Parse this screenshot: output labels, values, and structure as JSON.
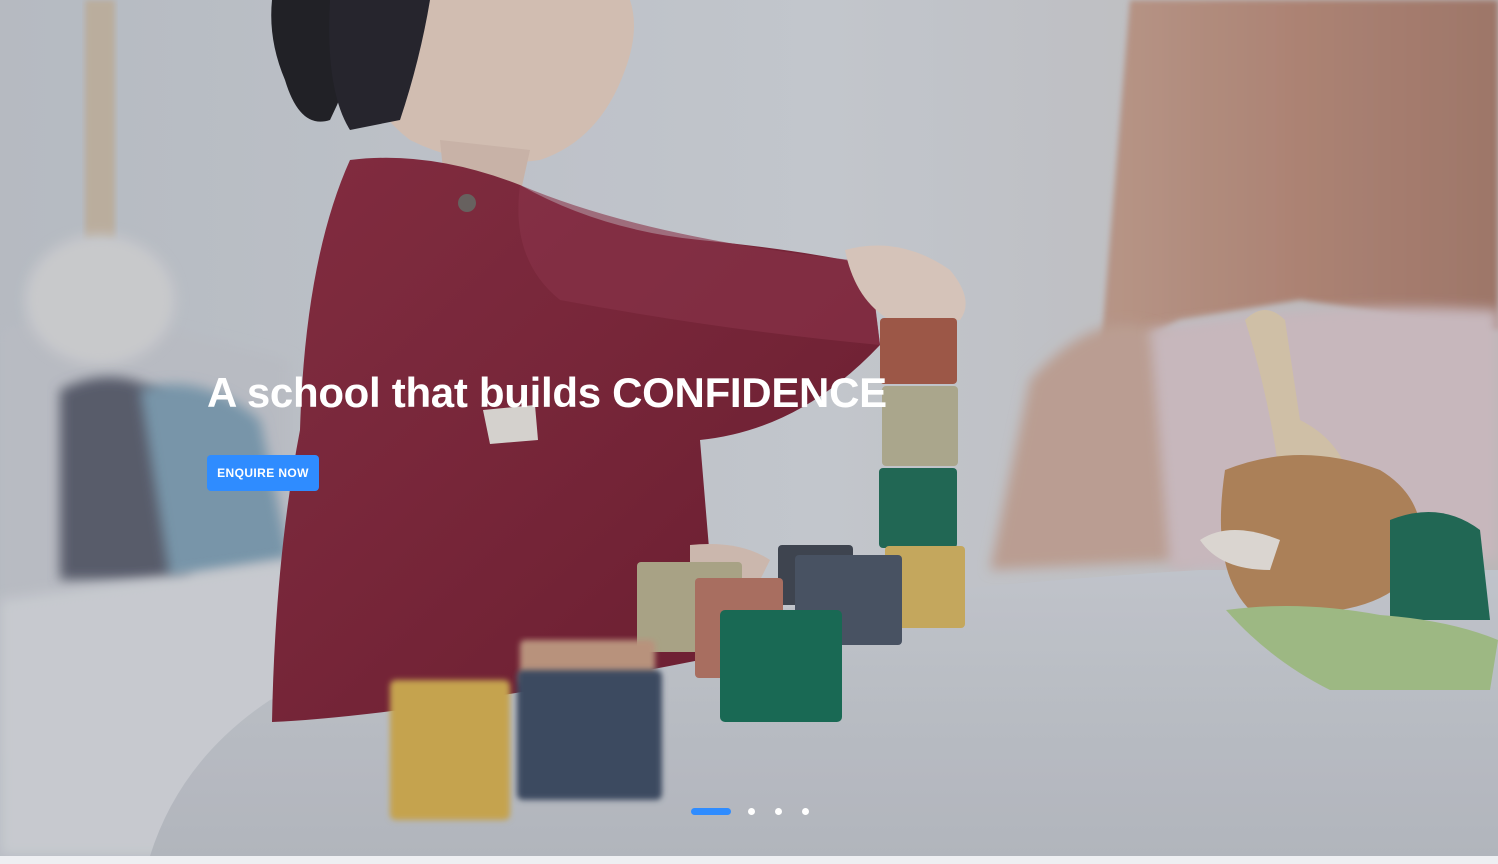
{
  "hero": {
    "headline": "A school that builds CONFIDENCE",
    "cta_label": "ENQUIRE NOW",
    "image_description_icon": "child-stacking-blocks-photo"
  },
  "carousel": {
    "slide_count": 4,
    "active_index": 0
  },
  "colors": {
    "accent": "#2f8cff",
    "headline": "#ffffff",
    "dress": "#7e1e34"
  }
}
